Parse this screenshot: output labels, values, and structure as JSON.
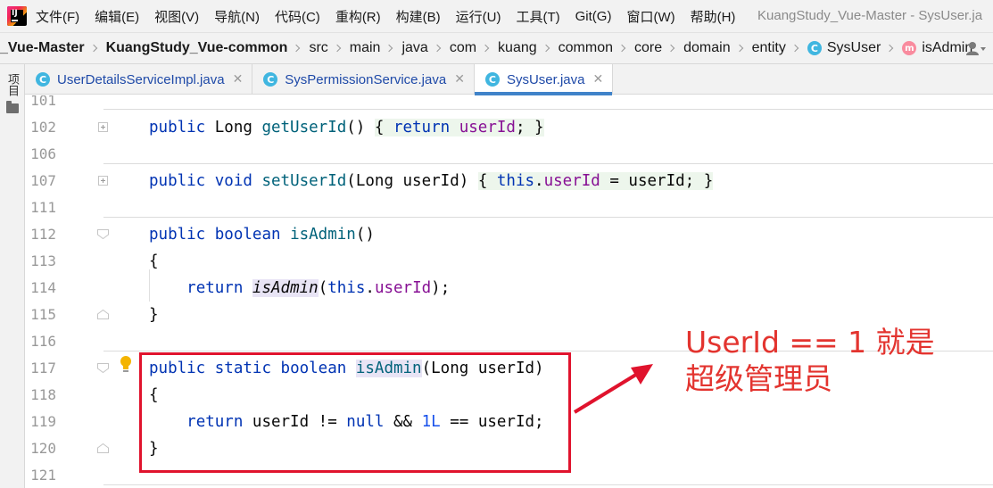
{
  "menubar": {
    "logo_text": "IJ",
    "items": [
      "文件(F)",
      "编辑(E)",
      "视图(V)",
      "导航(N)",
      "代码(C)",
      "重构(R)",
      "构建(B)",
      "运行(U)",
      "工具(T)",
      "Git(G)",
      "窗口(W)",
      "帮助(H)"
    ],
    "window_title": "KuangStudy_Vue-Master - SysUser.ja"
  },
  "breadcrumb": {
    "items": [
      {
        "label": "_Vue-Master",
        "bold": true
      },
      {
        "label": "KuangStudy_Vue-common",
        "bold": true
      },
      {
        "label": "src"
      },
      {
        "label": "main"
      },
      {
        "label": "java"
      },
      {
        "label": "com"
      },
      {
        "label": "kuang"
      },
      {
        "label": "common"
      },
      {
        "label": "core"
      },
      {
        "label": "domain"
      },
      {
        "label": "entity"
      },
      {
        "label": "SysUser",
        "icon": "class-icon"
      },
      {
        "label": "isAdmin",
        "icon": "method-icon"
      }
    ]
  },
  "tool_strip": {
    "project_label": "项目"
  },
  "tabs": [
    {
      "label": "UserDetailsServiceImpl.java",
      "active": false
    },
    {
      "label": "SysPermissionService.java",
      "active": false
    },
    {
      "label": "SysUser.java",
      "active": true
    }
  ],
  "icons": {
    "class_letter": "C",
    "method_letter": "m",
    "close_glyph": "✕"
  },
  "editor": {
    "lines": [
      {
        "num": "101"
      },
      {
        "num": "102",
        "code": "public Long getUserId() { return userId; }"
      },
      {
        "num": "106"
      },
      {
        "num": "107",
        "code": "public void setUserId(Long userId) { this.userId = userId; }"
      },
      {
        "num": "111"
      },
      {
        "num": "112",
        "code": "public boolean isAdmin()"
      },
      {
        "num": "113",
        "code": "{"
      },
      {
        "num": "114",
        "code": "    return isAdmin(this.userId);"
      },
      {
        "num": "115",
        "code": "}"
      },
      {
        "num": "116"
      },
      {
        "num": "117",
        "code": "public static boolean isAdmin(Long userId)"
      },
      {
        "num": "118",
        "code": "{"
      },
      {
        "num": "119",
        "code": "    return userId != null && 1L == userId;"
      },
      {
        "num": "120",
        "code": "}"
      },
      {
        "num": "121"
      }
    ]
  },
  "annotation": {
    "line1": "UserId == 1 就是",
    "line2": "超级管理员",
    "color": "#e0132d"
  }
}
